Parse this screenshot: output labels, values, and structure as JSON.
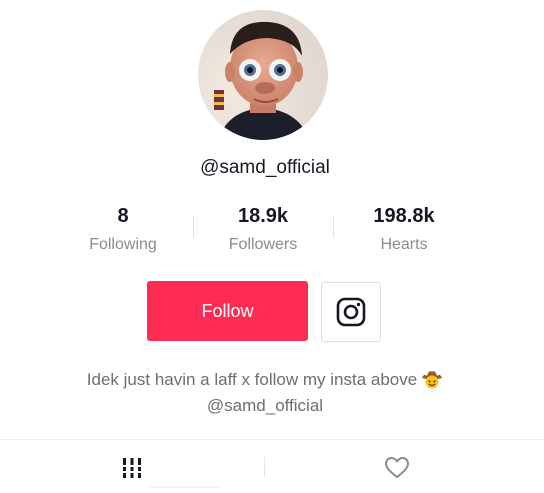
{
  "profile": {
    "username": "@samd_official",
    "avatar_icon": "profile-photo"
  },
  "stats": [
    {
      "value": "8",
      "label": "Following"
    },
    {
      "value": "18.9k",
      "label": "Followers"
    },
    {
      "value": "198.8k",
      "label": "Hearts"
    }
  ],
  "actions": {
    "follow_label": "Follow",
    "follow_color": "#fe2c55",
    "instagram_icon": "instagram-icon"
  },
  "bio": {
    "line1": "Idek just havin a laff x follow my insta above",
    "line2": "@samd_official",
    "emoji_icon": "cowboy-face-emoji"
  },
  "tabs": [
    {
      "icon": "videos-grid-icon",
      "selected": true
    },
    {
      "icon": "liked-heart-icon",
      "selected": false
    }
  ]
}
